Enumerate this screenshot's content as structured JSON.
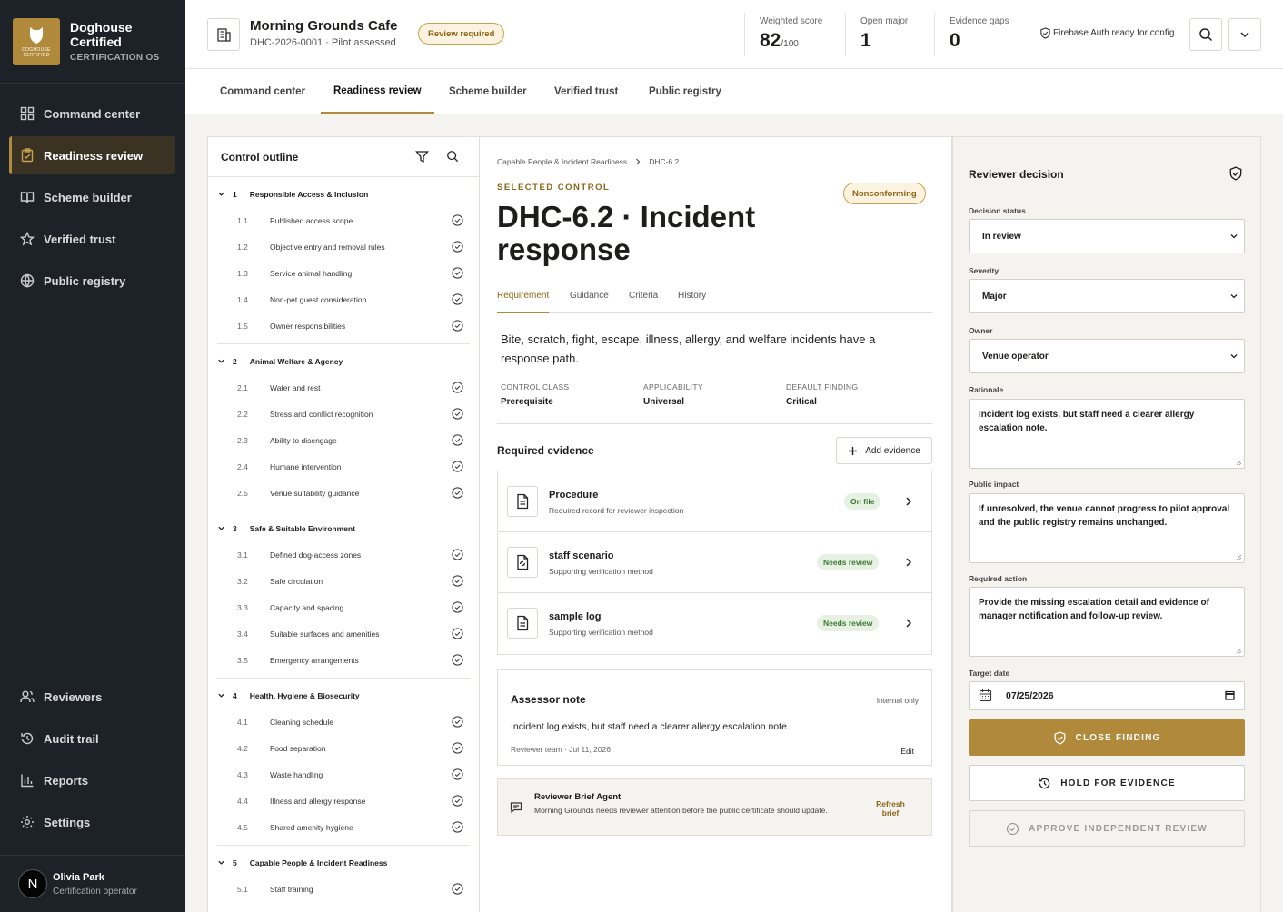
{
  "brand": {
    "name_line1": "Doghouse",
    "name_line2": "Certified",
    "subtitle": "CERTIFICATION OS",
    "logo_text": "DOGHOUSE CERTIFIED"
  },
  "nav": {
    "items": [
      {
        "label": "Command center",
        "icon": "grid-icon"
      },
      {
        "label": "Readiness review",
        "icon": "clipboard-icon",
        "active": true
      },
      {
        "label": "Scheme builder",
        "icon": "book-icon"
      },
      {
        "label": "Verified trust",
        "icon": "star-icon"
      },
      {
        "label": "Public registry",
        "icon": "globe-icon"
      }
    ],
    "bottom": [
      {
        "label": "Reviewers",
        "icon": "users-icon"
      },
      {
        "label": "Audit trail",
        "icon": "history-icon"
      },
      {
        "label": "Reports",
        "icon": "bar-chart-icon"
      },
      {
        "label": "Settings",
        "icon": "gear-icon"
      }
    ]
  },
  "user": {
    "initial": "N",
    "name": "Olivia Park",
    "role": "Certification operator"
  },
  "header": {
    "venue_name": "Morning Grounds Cafe",
    "venue_sub": "DHC-2026-0001 · Pilot assessed",
    "status_badge": "Review required",
    "metrics": [
      {
        "label": "Weighted score",
        "value": "82",
        "suffix": "/100"
      },
      {
        "label": "Open major",
        "value": "1",
        "suffix": ""
      },
      {
        "label": "Evidence gaps",
        "value": "0",
        "suffix": ""
      }
    ],
    "auth_status": "Firebase Auth ready for config"
  },
  "tabs": [
    "Command center",
    "Readiness review",
    "Scheme builder",
    "Verified trust",
    "Public registry"
  ],
  "outline": {
    "title": "Control outline",
    "sections": [
      {
        "num": "1",
        "title": "Responsible Access & Inclusion",
        "controls": [
          {
            "num": "1.1",
            "label": "Published access scope"
          },
          {
            "num": "1.2",
            "label": "Objective entry and removal rules"
          },
          {
            "num": "1.3",
            "label": "Service animal handling"
          },
          {
            "num": "1.4",
            "label": "Non-pet guest consideration"
          },
          {
            "num": "1.5",
            "label": "Owner responsibilities"
          }
        ]
      },
      {
        "num": "2",
        "title": "Animal Welfare & Agency",
        "controls": [
          {
            "num": "2.1",
            "label": "Water and rest"
          },
          {
            "num": "2.2",
            "label": "Stress and conflict recognition"
          },
          {
            "num": "2.3",
            "label": "Ability to disengage"
          },
          {
            "num": "2.4",
            "label": "Humane intervention"
          },
          {
            "num": "2.5",
            "label": "Venue suitability guidance"
          }
        ]
      },
      {
        "num": "3",
        "title": "Safe & Suitable Environment",
        "controls": [
          {
            "num": "3.1",
            "label": "Defined dog-access zones"
          },
          {
            "num": "3.2",
            "label": "Safe circulation"
          },
          {
            "num": "3.3",
            "label": "Capacity and spacing"
          },
          {
            "num": "3.4",
            "label": "Suitable surfaces and amenities"
          },
          {
            "num": "3.5",
            "label": "Emergency arrangements"
          }
        ]
      },
      {
        "num": "4",
        "title": "Health, Hygiene & Biosecurity",
        "controls": [
          {
            "num": "4.1",
            "label": "Cleaning schedule"
          },
          {
            "num": "4.2",
            "label": "Food separation"
          },
          {
            "num": "4.3",
            "label": "Waste handling"
          },
          {
            "num": "4.4",
            "label": "Illness and allergy response"
          },
          {
            "num": "4.5",
            "label": "Shared amenity hygiene"
          }
        ]
      },
      {
        "num": "5",
        "title": "Capable People & Incident Readiness",
        "controls": [
          {
            "num": "5.1",
            "label": "Staff training"
          }
        ]
      }
    ]
  },
  "detail": {
    "breadcrumb": [
      "Capable People & Incident Readiness",
      "DHC-6.2"
    ],
    "selected_label": "SELECTED CONTROL",
    "finding_badge": "Nonconforming",
    "title": "DHC-6.2 · Incident response",
    "tabs": [
      "Requirement",
      "Guidance",
      "Criteria",
      "History"
    ],
    "requirement": "Bite, scratch, fight, escape, illness, allergy, and welfare incidents have a response path.",
    "attributes": [
      {
        "label": "CONTROL CLASS",
        "value": "Prerequisite"
      },
      {
        "label": "APPLICABILITY",
        "value": "Universal"
      },
      {
        "label": "DEFAULT FINDING",
        "value": "Critical"
      }
    ],
    "evidence_title": "Required evidence",
    "add_evidence": "Add evidence",
    "evidence": [
      {
        "name": "Procedure",
        "desc": "Required record for reviewer inspection",
        "status": "On file",
        "icon": "document-icon"
      },
      {
        "name": "staff scenario",
        "desc": "Supporting verification method",
        "status": "Needs review",
        "icon": "file-sync-icon"
      },
      {
        "name": "sample log",
        "desc": "Supporting verification method",
        "status": "Needs review",
        "icon": "document-icon"
      }
    ],
    "note": {
      "title": "Assessor note",
      "visibility": "Internal only",
      "text": "Incident log exists, but staff need a clearer allergy escalation note.",
      "meta": "Reviewer team · Jul 11, 2026",
      "edit": "Edit"
    },
    "agent": {
      "title": "Reviewer Brief Agent",
      "text": "Morning Grounds needs reviewer attention before the public certificate should update.",
      "button": "Refresh brief"
    }
  },
  "decision": {
    "title": "Reviewer decision",
    "status_label": "Decision status",
    "status_value": "In review",
    "severity_label": "Severity",
    "severity_value": "Major",
    "owner_label": "Owner",
    "owner_value": "Venue operator",
    "rationale_label": "Rationale",
    "rationale": "Incident log exists, but staff need a clearer allergy escalation note.",
    "impact_label": "Public impact",
    "impact": "If unresolved, the venue cannot progress to pilot approval and the public registry remains unchanged.",
    "action_label": "Required action",
    "action": "Provide the missing escalation detail and evidence of manager notification and follow-up review.",
    "date_label": "Target date",
    "date_value": "07/25/2026",
    "close_btn": "CLOSE FINDING",
    "hold_btn": "HOLD FOR EVIDENCE",
    "approve_btn": "APPROVE INDEPENDENT REVIEW"
  },
  "colors": {
    "accent": "#b08a3a",
    "sidebar": "#1c2228",
    "success": "#3d7a33"
  }
}
